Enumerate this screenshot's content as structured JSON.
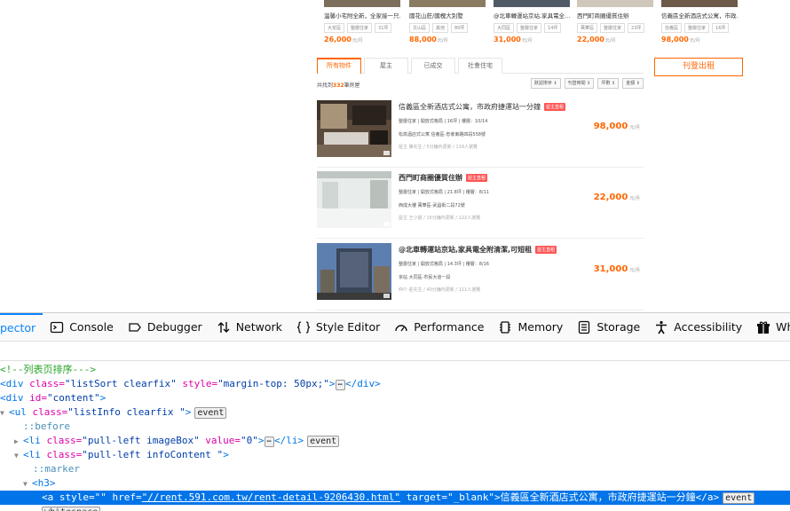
{
  "top_cards": [
    {
      "title": "溫馨小宅附全新，全家接一只...",
      "tags": [
        "大安區",
        "整層住家",
        "31坪"
      ],
      "price": "26,000",
      "unit": "元/月"
    },
    {
      "title": "國花山莊/國槐大別墅",
      "tags": [
        "文山區",
        "其他",
        "80坪"
      ],
      "price": "88,000",
      "unit": "元/月"
    },
    {
      "title": "@北車轉運站京站,家具電全...",
      "tags": [
        "大同區",
        "整層住家",
        "14坪"
      ],
      "price": "31,000",
      "unit": "元/月"
    },
    {
      "title": "西門町商圈優質住辦",
      "tags": [
        "萬華區",
        "整層住家",
        "23坪"
      ],
      "price": "22,000",
      "unit": "元/月"
    },
    {
      "title": "信義區全新酒店式公寓，市政...",
      "tags": [
        "信義區",
        "整層住家",
        "16坪"
      ],
      "price": "98,000",
      "unit": "元/月"
    }
  ],
  "tabs": [
    "所有物件",
    "屋主",
    "已成交",
    "社會住宅"
  ],
  "rent_button": "刊登出租",
  "count": {
    "prefix": "共找到",
    "number": "332",
    "suffix": "筆房屋"
  },
  "sorts": [
    "默認排序 ⇕",
    "刊登時間 ⇕",
    "坪數 ⇕",
    "金額 ⇕"
  ],
  "listings": [
    {
      "title": "信義區全新酒店式公寓，市政府捷運站一分鐘",
      "badge": "屋主直租",
      "meta": "整層住家 | 開放式格局 | 16坪 | 樓層：10/14",
      "addr": "松高酒店式公寓 信義區-忠孝東路四段558號",
      "info": "屋主 陳先生 / 5分鐘內更新 / 118人瀏覽",
      "price": "98,000",
      "unit": "元/月",
      "bold": false
    },
    {
      "title": "西門町商圈優質住辦",
      "badge": "屋主直租",
      "meta": "整層住家 | 開放式格局 | 21.8坪 | 樓層：8/11",
      "addr": "西成大樓 萬華區-武昌街二段72號",
      "info": "屋主 王小姐 / 15分鐘內更新 / 122人瀏覽",
      "price": "22,000",
      "unit": "元/月",
      "bold": true
    },
    {
      "title": "@北車轉運站京站,家具電全附清潔,可短租",
      "badge": "屋主直租",
      "meta": "整層住家 | 開放式格局 | 14.3坪 | 樓層：8/16",
      "addr": "京站 大同區-市民大道一段",
      "info": "仲介 莊先生 / 40分鐘內更新 / 111人瀏覽",
      "price": "31,000",
      "unit": "元/月",
      "bold": true
    }
  ],
  "devtools": {
    "tabs": [
      {
        "label": "pector",
        "icon": "inspector-icon"
      },
      {
        "label": "Console",
        "icon": "console-icon"
      },
      {
        "label": "Debugger",
        "icon": "debugger-icon"
      },
      {
        "label": "Network",
        "icon": "network-icon"
      },
      {
        "label": "Style Editor",
        "icon": "style-editor-icon"
      },
      {
        "label": "Performance",
        "icon": "performance-icon"
      },
      {
        "label": "Memory",
        "icon": "memory-icon"
      },
      {
        "label": "Storage",
        "icon": "storage-icon"
      },
      {
        "label": "Accessibility",
        "icon": "accessibility-icon"
      },
      {
        "label": "What's New",
        "icon": "gift-icon"
      }
    ],
    "lines": {
      "l0": "<!--列表页排序--->",
      "l1_tag": "<div",
      "l1_attr1": " class=",
      "l1_val1": "\"listSort clearfix\"",
      "l1_attr2": " style=",
      "l1_val2": "\"margin-top: 50px;\"",
      "l1_close": ">",
      "l1_end": "</div>",
      "l2_tag": "<div",
      "l2_attr": " id=",
      "l2_val": "\"content\"",
      "l2_close": ">",
      "l3_tag": "<ul",
      "l3_attr": " class=",
      "l3_val": "\"listInfo clearfix \"",
      "l3_close": ">",
      "l4": "::before",
      "l5_tag": "<li",
      "l5_attr1": " class=",
      "l5_val1": "\"pull-left imageBox\"",
      "l5_attr2": " value=",
      "l5_val2": "\"0\"",
      "l5_close": ">",
      "l5_end": "</li>",
      "l6_tag": "<li",
      "l6_attr": " class=",
      "l6_val": "\"pull-left infoContent \"",
      "l6_close": ">",
      "l7": "::marker",
      "l8": "<h3>",
      "l9_tag": "<a",
      "l9_attr1": " style=",
      "l9_val1": "\"\"",
      "l9_attr2": " href=",
      "l9_val2": "\"//rent.591.com.tw/rent-detail-9206430.html\"",
      "l9_attr3": " target=",
      "l9_val3": "\"_blank\"",
      "l9_text": ">信義區全新酒店式公寓，市政府捷運站一分鐘</a>",
      "l10": "whitespace",
      "event": "event",
      "ellipsis": "⋯"
    }
  }
}
